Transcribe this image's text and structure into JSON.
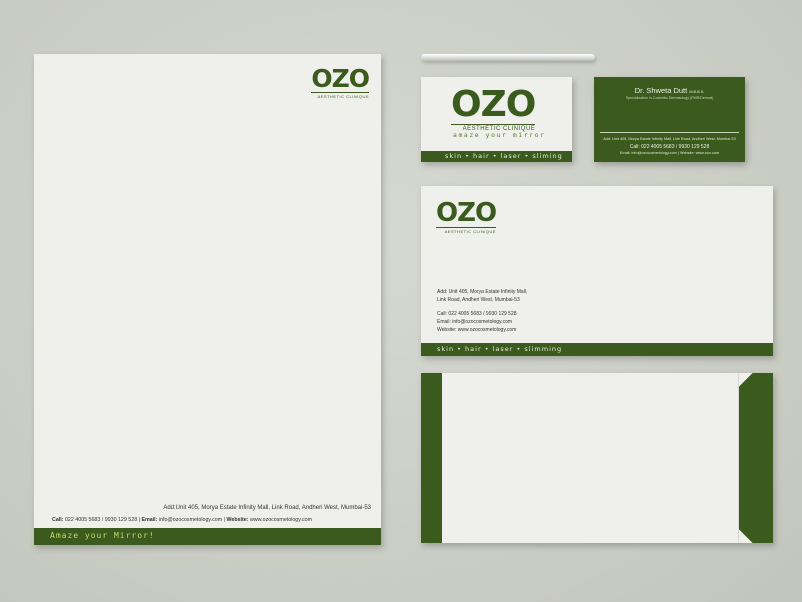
{
  "brand": {
    "logo": "OZO",
    "logo_sub": "AESTHETIC CLINIQUE",
    "tagline_card": "amaze your mirror",
    "services": "skin • hair • laser • sliming",
    "services_envelope": "skin • hair • laser • slimming",
    "color_primary": "#3b5a1e",
    "color_accent": "#c6d96a"
  },
  "letterhead": {
    "address": "Add:Unit 405, Morya Estate Infinity Mall, Link Road, Andheri West, Mumbai-53",
    "call_label": "Call:",
    "call": "022 4005 5683 / 9930 129 528",
    "email_label": "Email:",
    "email": "info@ozocosmetology.com",
    "website_label": "Website:",
    "website": "www.ozocosmetology.com",
    "tagline": "Amaze your Mirror!"
  },
  "card_back": {
    "name": "Dr. Shweta Dutt",
    "degree": "M.B.B.S.",
    "specialty": "Specialization in Cosmetic Dermatology (PMR/Dermat)",
    "address": "Add: Unit 405, Morya Estate Infinity Mall, Link Road, Andheri West, Mumbai-53",
    "call": "Call: 022 4005 5683 / 9930 129 528",
    "email_web": "Email: info@ozocosmetology.com | Website: www.ozo.com"
  },
  "envelope": {
    "address_line1": "Add: Unit 405, Morya Estate Infinity Mall,",
    "address_line2": "Link Road, Andheri West, Mumbai-53",
    "call": "Call: 022 4005 5683 / 9930 129 528",
    "email": "Email: info@ozocosmetology.com",
    "website": "Website: www.ozocosmetology.com"
  }
}
